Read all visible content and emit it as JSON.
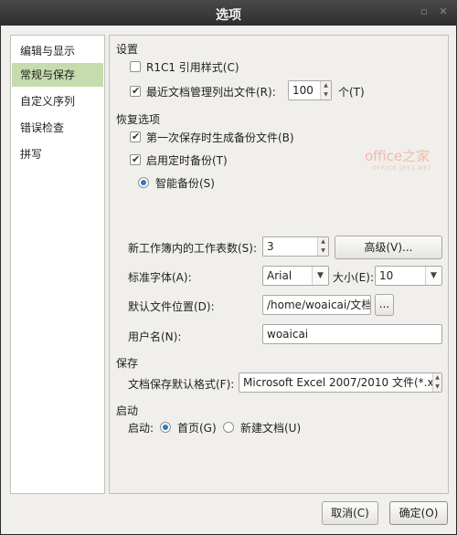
{
  "window": {
    "title": "选项"
  },
  "sidebar": {
    "items": [
      {
        "label": "编辑与显示"
      },
      {
        "label": "常规与保存"
      },
      {
        "label": "自定义序列"
      },
      {
        "label": "错误检查"
      },
      {
        "label": "拼写"
      }
    ]
  },
  "settings": {
    "heading": "设置",
    "r1c1": {
      "label": "R1C1 引用样式(C)",
      "checked": false
    },
    "recent": {
      "label": "最近文档管理列出文件(R):",
      "value": "100",
      "unit": "个(T)",
      "checked": true
    }
  },
  "recovery": {
    "heading": "恢复选项",
    "first_save": {
      "label": "第一次保存时生成备份文件(B)",
      "checked": true
    },
    "timed": {
      "label": "启用定时备份(T)",
      "checked": true
    },
    "smart": {
      "label": "智能备份(S)",
      "selected": true
    }
  },
  "general": {
    "sheets": {
      "label": "新工作簿内的工作表数(S):",
      "value": "3"
    },
    "advanced_button": "高级(V)...",
    "font": {
      "label": "标准字体(A):",
      "value": "Arial"
    },
    "size": {
      "label": "大小(E):",
      "value": "10"
    },
    "location": {
      "label": "默认文件位置(D):",
      "value": "/home/woaicai/文档",
      "browse": "..."
    },
    "username": {
      "label": "用户名(N):",
      "value": "woaicai"
    }
  },
  "save": {
    "heading": "保存",
    "format": {
      "label": "文档保存默认格式(F):",
      "value": "Microsoft Excel 2007/2010 文件(*.xl"
    }
  },
  "startup": {
    "heading": "启动",
    "label": "启动:",
    "home": {
      "label": "首页(G)",
      "selected": true
    },
    "new_doc": {
      "label": "新建文档(U)",
      "selected": false
    }
  },
  "buttons": {
    "cancel": "取消(C)",
    "ok": "确定(O)"
  },
  "watermark": {
    "main": "office之家",
    "sub": "OFFICE.JB51.NET"
  },
  "colors": {
    "accent": "#2f78c4",
    "sidebar_active": "#c6dcae",
    "titlebar": "#3a3a3a"
  }
}
